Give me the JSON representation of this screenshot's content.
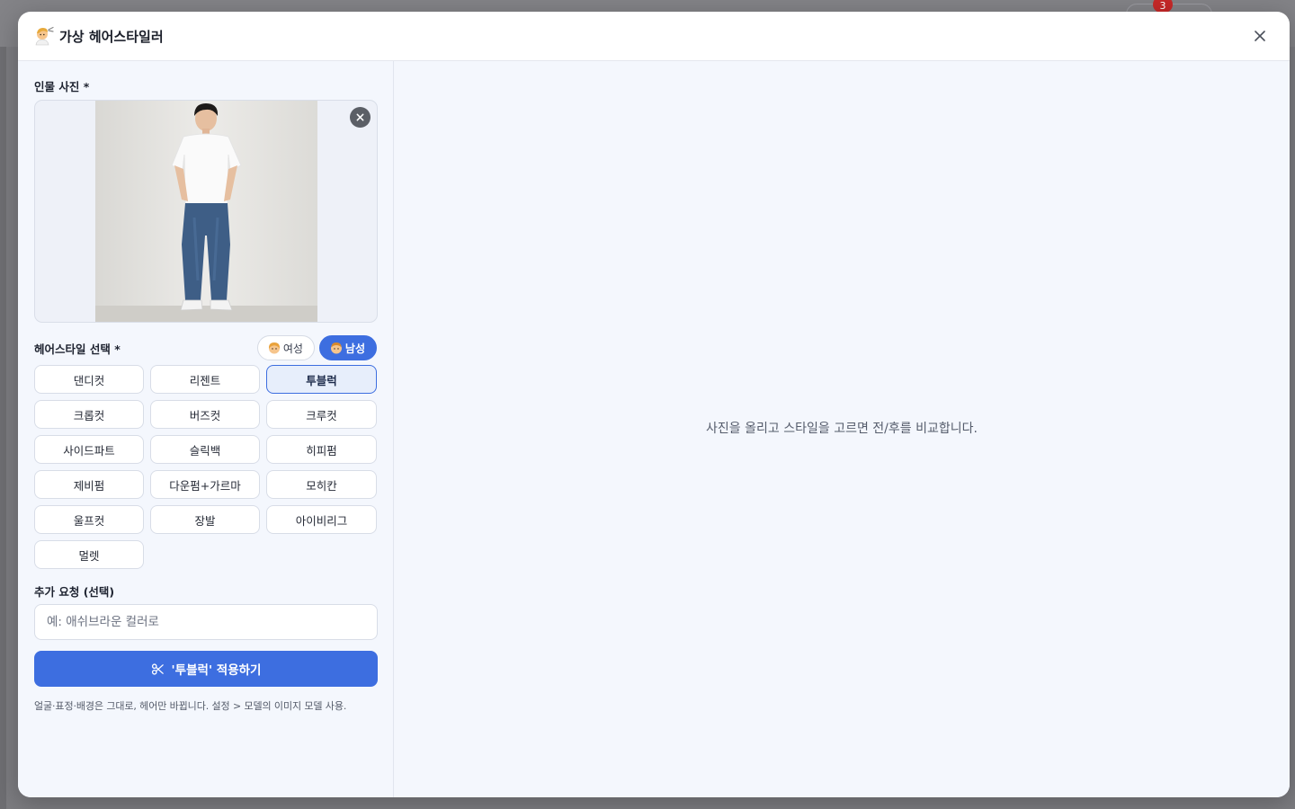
{
  "background": {
    "badge_count": "3"
  },
  "modal": {
    "title": "가상 헤어스타일러",
    "title_icon": "barber-person-icon",
    "close_icon": "close-icon"
  },
  "left": {
    "photo_label": "인물 사진 *",
    "style_label": "헤어스타일 선택 *",
    "gender": {
      "female": "여성",
      "male": "남성",
      "active": "male"
    },
    "styles": [
      "댄디컷",
      "리젠트",
      "투블럭",
      "크롭컷",
      "버즈컷",
      "크루컷",
      "사이드파트",
      "슬릭백",
      "히피펌",
      "제비펌",
      "다운펌+가르마",
      "모히칸",
      "울프컷",
      "장발",
      "아이비리그",
      "멀렛"
    ],
    "selected_style": "투블럭",
    "extra_label": "추가 요청 (선택)",
    "extra_placeholder": "예: 애쉬브라운 컬러로",
    "apply_label": "'투블럭' 적용하기",
    "hint": "얼굴·표정·배경은 그대로, 헤어만 바뀝니다. 설정 > 모델의 이미지 모델 사용."
  },
  "right": {
    "placeholder": "사진을 올리고 스타일을 고르면 전/후를 비교합니다."
  },
  "colors": {
    "accent": "#3d6ee0",
    "panel_bg": "#f4f7fd"
  }
}
